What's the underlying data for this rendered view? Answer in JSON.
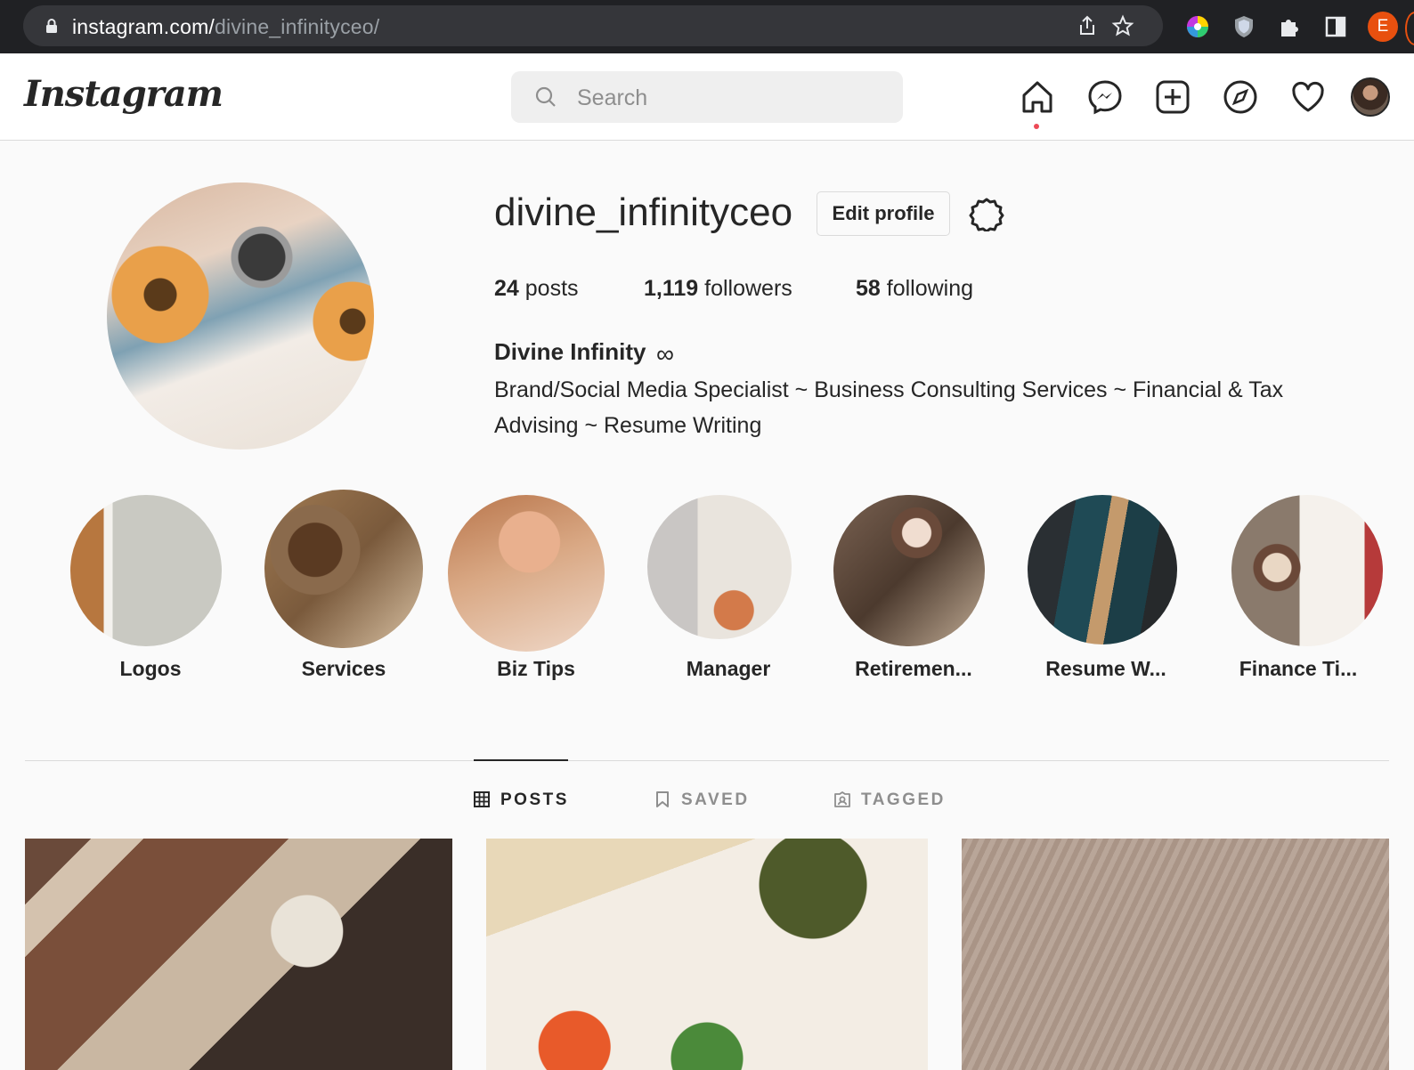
{
  "browser": {
    "url_domain": "instagram.com/",
    "url_path": "divine_infinityceo/",
    "profile_initial": "E",
    "icons": [
      "lock-icon",
      "share-icon",
      "star-icon",
      "color-wheel-icon",
      "shield-icon",
      "puzzle-icon",
      "sidepanel-icon"
    ]
  },
  "header": {
    "logo": "Instagram",
    "search_placeholder": "Search",
    "nav_icons": [
      "home-icon",
      "messenger-icon",
      "new-post-icon",
      "explore-icon",
      "activity-heart-icon",
      "profile-avatar"
    ]
  },
  "profile": {
    "username": "divine_infinityceo",
    "edit_button": "Edit profile",
    "stats": {
      "posts_count": "24",
      "posts_label": " posts",
      "followers_count": "1,119",
      "followers_label": " followers",
      "following_count": "58",
      "following_label": " following"
    },
    "full_name": "Divine Infinity",
    "name_symbol": "∞",
    "bio": "Brand/Social Media Specialist ~ Business Consulting Services ~ Financial & Tax Advising ~ Resume Writing"
  },
  "highlights": [
    {
      "label": "Logos"
    },
    {
      "label": "Services"
    },
    {
      "label": "Biz Tips"
    },
    {
      "label": "Manager"
    },
    {
      "label": "Retiremen..."
    },
    {
      "label": "Resume W..."
    },
    {
      "label": "Finance Ti..."
    }
  ],
  "tabs": [
    {
      "label": "POSTS",
      "active": true
    },
    {
      "label": "SAVED",
      "active": false
    },
    {
      "label": "TAGGED",
      "active": false
    }
  ],
  "colors": {
    "accent_dot": "#ed4956",
    "text": "#262626",
    "muted": "#8e8e8e",
    "border": "#dbdbdb"
  }
}
